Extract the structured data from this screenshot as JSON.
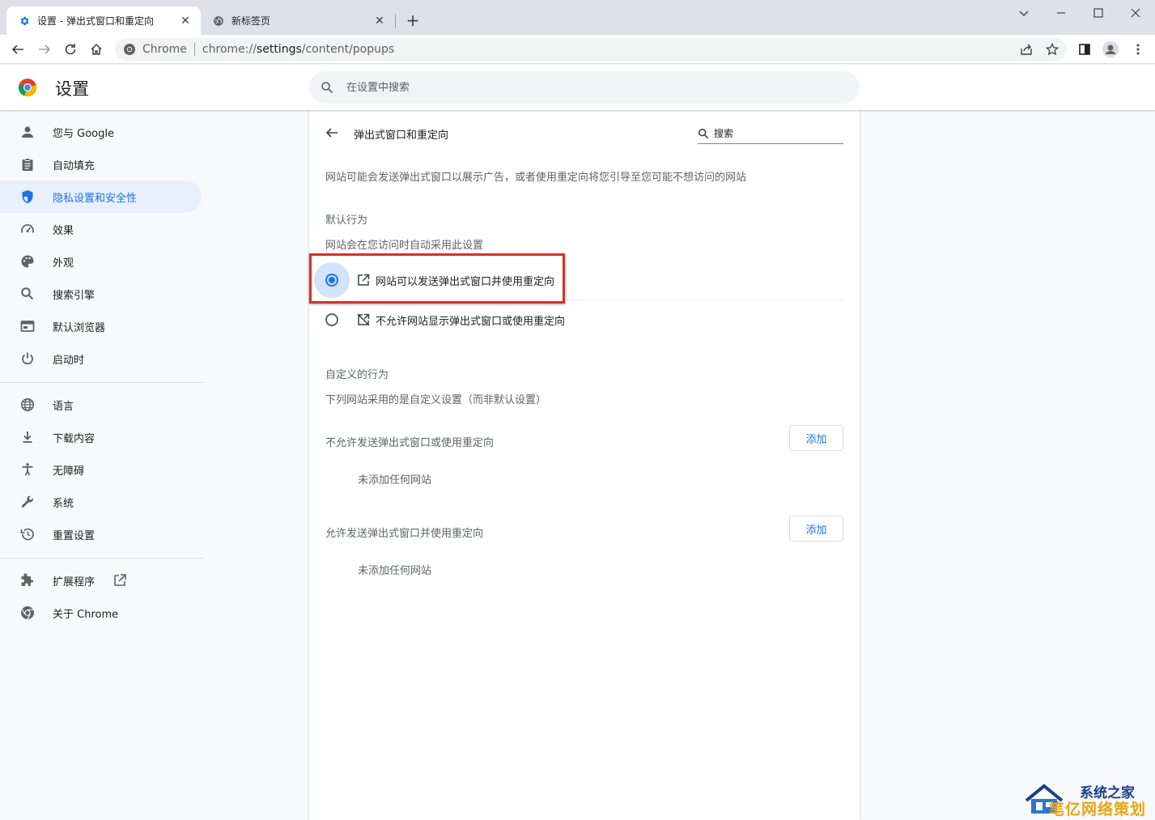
{
  "browser": {
    "tabs": [
      {
        "title": "设置 - 弹出式窗口和重定向",
        "active": true
      },
      {
        "title": "新标签页",
        "active": false
      }
    ],
    "omnibox": {
      "scheme": "Chrome",
      "url_prefix": "chrome://",
      "url_host": "settings",
      "url_path": "/content/popups"
    }
  },
  "header": {
    "title": "设置",
    "search_placeholder": "在设置中搜索"
  },
  "sidebar": {
    "items": [
      {
        "label": "您与 Google",
        "icon": "person-icon"
      },
      {
        "label": "自动填充",
        "icon": "assignment-icon"
      },
      {
        "label": "隐私设置和安全性",
        "icon": "shield-icon",
        "selected": true
      },
      {
        "label": "效果",
        "icon": "speed-icon"
      },
      {
        "label": "外观",
        "icon": "palette-icon"
      },
      {
        "label": "搜索引擎",
        "icon": "search-icon"
      },
      {
        "label": "默认浏览器",
        "icon": "browser-icon"
      },
      {
        "label": "启动时",
        "icon": "power-icon"
      },
      {
        "label": "语言",
        "icon": "globe-icon"
      },
      {
        "label": "下载内容",
        "icon": "download-icon"
      },
      {
        "label": "无障碍",
        "icon": "accessibility-icon"
      },
      {
        "label": "系统",
        "icon": "wrench-icon"
      },
      {
        "label": "重置设置",
        "icon": "restore-icon"
      },
      {
        "label": "扩展程序",
        "icon": "puzzle-icon"
      },
      {
        "label": "关于 Chrome",
        "icon": "chrome-icon"
      }
    ]
  },
  "page": {
    "title": "弹出式窗口和重定向",
    "search_placeholder": "搜索",
    "description": "网站可能会发送弹出式窗口以展示广告，或者使用重定向将您引导至您可能不想访问的网站",
    "default_heading": "默认行为",
    "default_sub": "网站会在您访问时自动采用此设置",
    "options": [
      {
        "label": "网站可以发送弹出式窗口并使用重定向",
        "checked": true,
        "icon": "open-in-new-icon"
      },
      {
        "label": "不允许网站显示弹出式窗口或使用重定向",
        "checked": false,
        "icon": "block-popup-icon"
      }
    ],
    "custom_heading": "自定义的行为",
    "custom_sub": "下列网站采用的是自定义设置（而非默认设置）",
    "lists": [
      {
        "title": "不允许发送弹出式窗口或使用重定向",
        "add_label": "添加",
        "empty": "未添加任何网站"
      },
      {
        "title": "允许发送弹出式窗口并使用重定向",
        "add_label": "添加",
        "empty": "未添加任何网站"
      }
    ]
  },
  "watermark": {
    "line1": "系统之家",
    "line2": "笔亿网络策划"
  },
  "colors": {
    "accent": "#1a73e8",
    "highlight": "#d93025",
    "selected_bg": "#e8f0fe"
  }
}
